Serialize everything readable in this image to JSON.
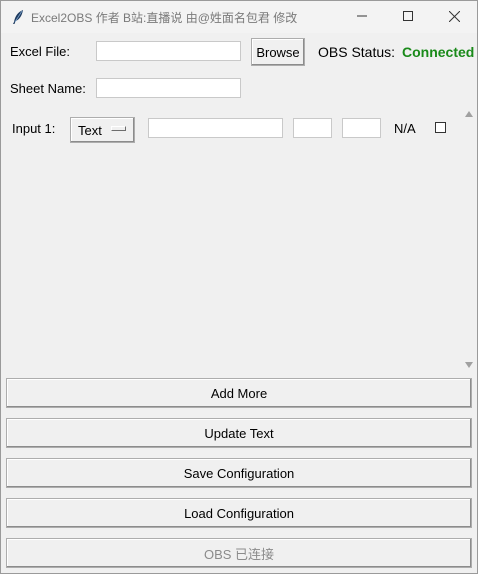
{
  "window": {
    "title": "Excel2OBS 作者 B站:直播说 由@姓面名包君 修改",
    "controls": [
      "minimize",
      "maximize",
      "close"
    ]
  },
  "form": {
    "excel_file_label": "Excel File:",
    "excel_file_value": "",
    "browse_label": "Browse",
    "obs_status_label": "OBS Status:",
    "obs_status_value": "Connected",
    "sheet_name_label": "Sheet Name:",
    "sheet_name_value": ""
  },
  "inputs": [
    {
      "label": "Input 1:",
      "type_selected": "Text",
      "source_value": "",
      "row_value": "",
      "col_value": "",
      "preview": "N/A",
      "checked": false
    }
  ],
  "buttons": {
    "add_more": "Add More",
    "update_text": "Update Text",
    "save_config": "Save Configuration",
    "load_config": "Load Configuration",
    "obs_connected": "OBS 已连接"
  },
  "colors": {
    "status_connected": "#1a8a1a",
    "window_bg": "#f0f0f0"
  },
  "icons": {
    "app": "feather-icon",
    "scroll_up": "triangle-up-icon",
    "scroll_down": "triangle-down-icon"
  }
}
